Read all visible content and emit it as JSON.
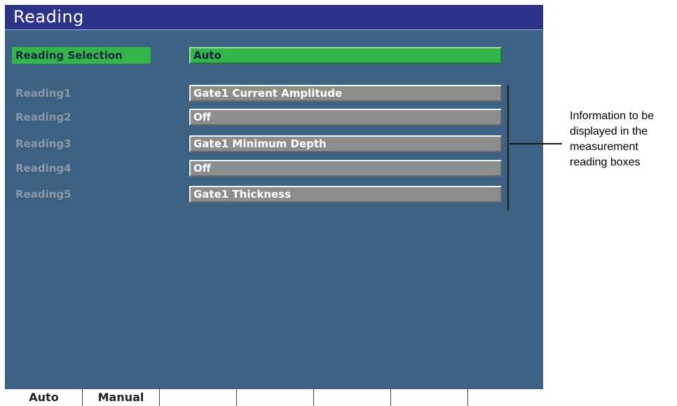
{
  "title": "Reading",
  "reading_selection": {
    "label": "Reading Selection",
    "value": "Auto"
  },
  "readings": [
    {
      "label": "Reading1",
      "value": "Gate1 Current Amplitude"
    },
    {
      "label": "Reading2",
      "value": "Off"
    },
    {
      "label": "Reading3",
      "value": "Gate1 Minimum Depth"
    },
    {
      "label": "Reading4",
      "value": "Off"
    },
    {
      "label": "Reading5",
      "value": "Gate1 Thickness"
    }
  ],
  "annotation": "Information to be displayed in the measurement reading boxes",
  "softkeys": [
    "Auto",
    "Manual",
    "",
    "",
    "",
    "",
    ""
  ],
  "colors": {
    "background": "#3d6183",
    "title_bar": "#2d3487",
    "selection": "#33b54a",
    "value_box": "#8d8d8d",
    "label_text": "#8c98a6"
  }
}
